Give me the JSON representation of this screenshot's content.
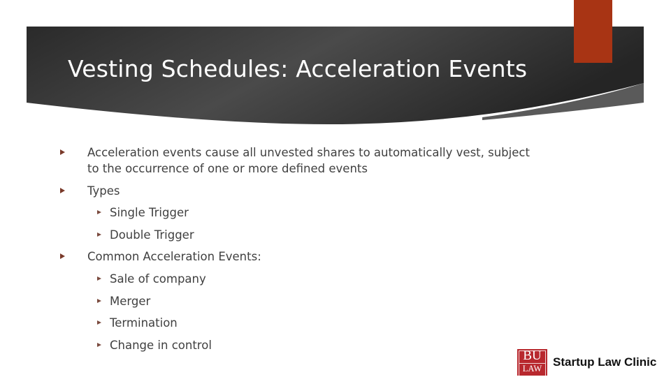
{
  "slide": {
    "title": "Vesting Schedules: Acceleration Events",
    "colors": {
      "banner_dark": "#2b2b2b",
      "banner_mid": "#4a4a4a",
      "banner_wedge": "#5a5a5a",
      "accent": "#a83414",
      "bullet": "#7a3a2a",
      "body_text": "#404040"
    },
    "bullets": [
      {
        "level": 1,
        "lines": [
          "Acceleration events cause all unvested shares to automatically vest, subject",
          "to the occurrence of one or more defined events"
        ]
      },
      {
        "level": 1,
        "text": "Types"
      },
      {
        "level": 2,
        "text": "Single Trigger"
      },
      {
        "level": 2,
        "text": "Double Trigger"
      },
      {
        "level": 1,
        "text": "Common Acceleration Events:"
      },
      {
        "level": 2,
        "text": "Sale of company"
      },
      {
        "level": 2,
        "text": "Merger"
      },
      {
        "level": 2,
        "text": "Termination"
      },
      {
        "level": 2,
        "text": "Change in control"
      }
    ]
  },
  "logo": {
    "mark_top": "BU",
    "mark_bottom": "LAW",
    "name": "Startup Law Clinic",
    "color": "#b8282e"
  }
}
